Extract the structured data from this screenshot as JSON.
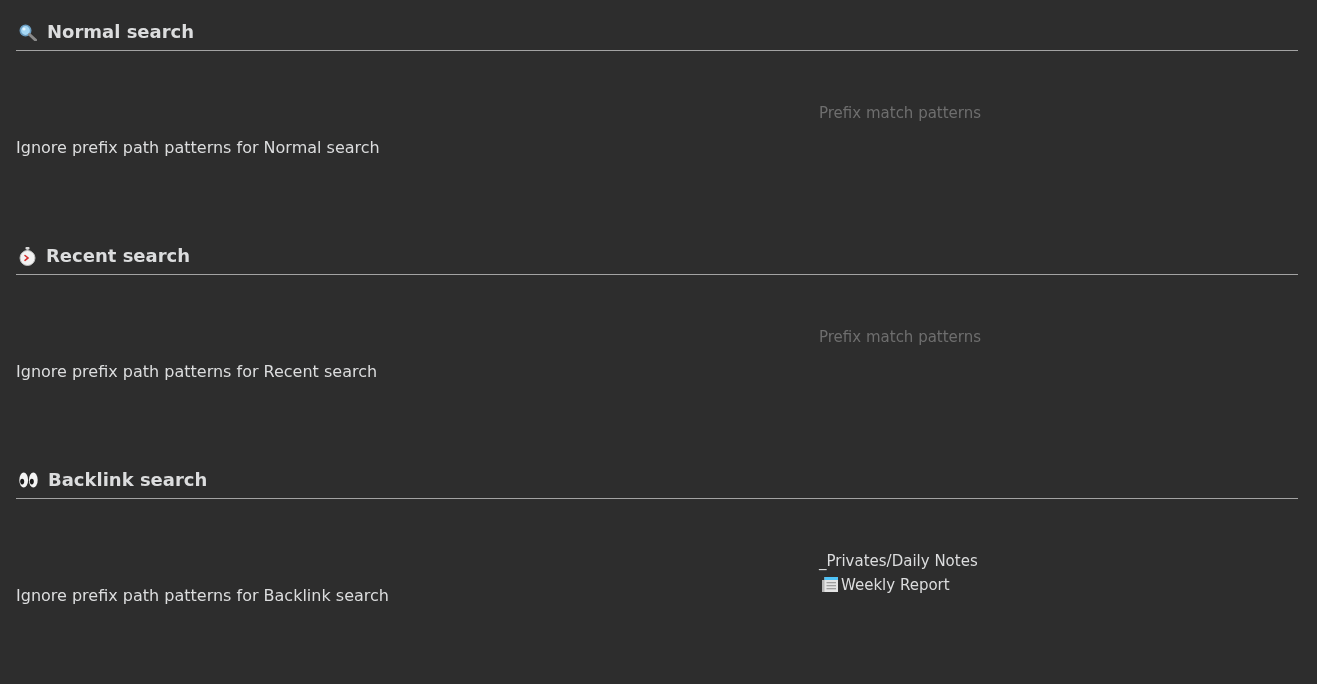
{
  "sections": [
    {
      "title": "Normal search",
      "setting": {
        "label": "Ignore prefix path patterns for Normal search",
        "field": {
          "placeholder": "Prefix match patterns"
        }
      }
    },
    {
      "title": "Recent search",
      "setting": {
        "label": "Ignore prefix path patterns for Recent search",
        "field": {
          "placeholder": "Prefix match patterns"
        }
      }
    },
    {
      "title": "Backlink search",
      "setting": {
        "label": "Ignore prefix path patterns for Backlink search",
        "field": {
          "lines": [
            {
              "text": "_Privates/Daily Notes",
              "icon": false
            },
            {
              "text": "Weekly Report",
              "icon": true
            }
          ]
        }
      }
    }
  ]
}
